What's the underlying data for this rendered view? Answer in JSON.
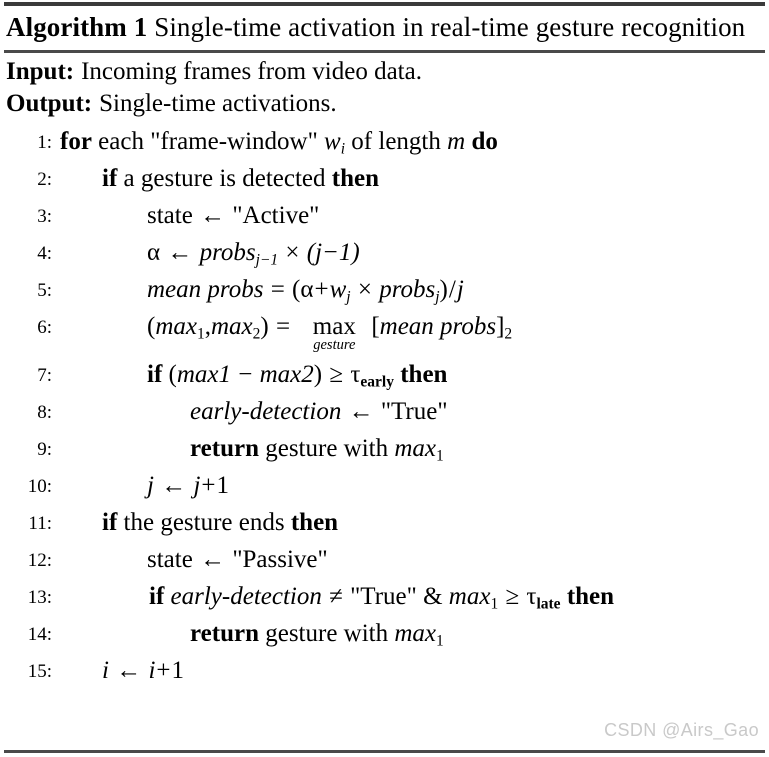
{
  "title": {
    "keyword": "Algorithm",
    "number": "1",
    "text": "Single-time activation in real-time gesture recognition"
  },
  "io": {
    "input_label": "Input:",
    "input_value": "Incoming frames from video data.",
    "output_label": "Output:",
    "output_value": "Single-time activations."
  },
  "lines": [
    {
      "num": "1:",
      "indent": "i0",
      "text": "for each \"frame-window\" w_i of length m do",
      "parts": {
        "kw1": "for",
        "mid": "each \"frame-window\"",
        "var1": "w",
        "sub1": "i",
        "mid2": "of length",
        "var2": "m",
        "kw2": "do"
      }
    },
    {
      "num": "2:",
      "indent": "i1",
      "text": "if a gesture is detected then",
      "parts": {
        "kw1": "if",
        "mid": "a gesture is detected",
        "kw2": "then"
      }
    },
    {
      "num": "3:",
      "indent": "i2",
      "text": "state ← \"Active\"",
      "parts": {
        "lhs": "state",
        "arrow": "←",
        "rhs": "\"Active\""
      }
    },
    {
      "num": "4:",
      "indent": "i2",
      "text": "α ← probs_{j−1} × (j−1)",
      "parts": {
        "alpha": "α",
        "arrow": "←",
        "fn": "probs",
        "sub": "j−1",
        "times": "×",
        "group": "(j−1)"
      }
    },
    {
      "num": "5:",
      "indent": "i2",
      "text": "mean probs = (α + w_j × probs_j)/j",
      "parts": {
        "lhs": "mean probs",
        "eq": "=",
        "alpha": "α",
        "plus": "+",
        "w": "w",
        "wsub": "j",
        "times": "×",
        "fn": "probs",
        "fnsub": "j",
        "div": "/",
        "j": "j"
      }
    },
    {
      "num": "6:",
      "indent": "i2",
      "text": "(max_1, max_2) = max_gesture [mean probs]_2",
      "parts": {
        "max1": "max",
        "s1": "1",
        "max2": "max",
        "s2": "2",
        "eq": "=",
        "op": "max",
        "opsub": "gesture",
        "arg": "mean probs",
        "argsub": "2"
      }
    },
    {
      "num": "7:",
      "indent": "i2",
      "text": "if (max1 − max2) ≥ τ_early then",
      "parts": {
        "kw1": "if",
        "a": "max1",
        "minus": "−",
        "b": "max2",
        "geq": "≥",
        "tau": "τ",
        "tausub": "early",
        "kw2": "then"
      }
    },
    {
      "num": "8:",
      "indent": "i3",
      "text": "early-detection ← \"True\"",
      "parts": {
        "lhs": "early-detection",
        "arrow": "←",
        "rhs": "\"True\""
      }
    },
    {
      "num": "9:",
      "indent": "i3",
      "text": "return gesture with max_1",
      "parts": {
        "kw1": "return",
        "mid": "gesture with",
        "var": "max",
        "sub": "1"
      }
    },
    {
      "num": "10:",
      "indent": "i2",
      "text": "j ← j + 1",
      "parts": {
        "lhs": "j",
        "arrow": "←",
        "rhs": "j",
        "plus": "+",
        "one": "1"
      }
    },
    {
      "num": "11:",
      "indent": "i1",
      "text": "if the gesture ends then",
      "parts": {
        "kw1": "if",
        "mid": "the gesture ends",
        "kw2": "then"
      }
    },
    {
      "num": "12:",
      "indent": "i2",
      "text": "state ← \"Passive\"",
      "parts": {
        "lhs": "state",
        "arrow": "←",
        "rhs": "\"Passive\""
      }
    },
    {
      "num": "13:",
      "indent": "i2b",
      "text": "if early-detection ≠ \"True\" & max_1 ≥ τ_late then",
      "parts": {
        "kw1": "if",
        "lhs": "early-detection",
        "neq": "≠",
        "rhs": "\"True\"",
        "amp": "&",
        "var": "max",
        "sub": "1",
        "geq": "≥",
        "tau": "τ",
        "tausub": "late",
        "kw2": "then"
      }
    },
    {
      "num": "14:",
      "indent": "i3",
      "text": "return gesture with max_1",
      "parts": {
        "kw1": "return",
        "mid": "gesture with",
        "var": "max",
        "sub": "1"
      }
    },
    {
      "num": "15:",
      "indent": "i1",
      "text": "i ← i + 1",
      "parts": {
        "lhs": "i",
        "arrow": "←",
        "rhs": "i",
        "plus": "+",
        "one": "1"
      }
    }
  ],
  "watermark": "CSDN @Airs_Gao",
  "colors": {
    "rule": "#4a4a4a",
    "text": "#000000",
    "watermark": "#c9c9c9"
  }
}
